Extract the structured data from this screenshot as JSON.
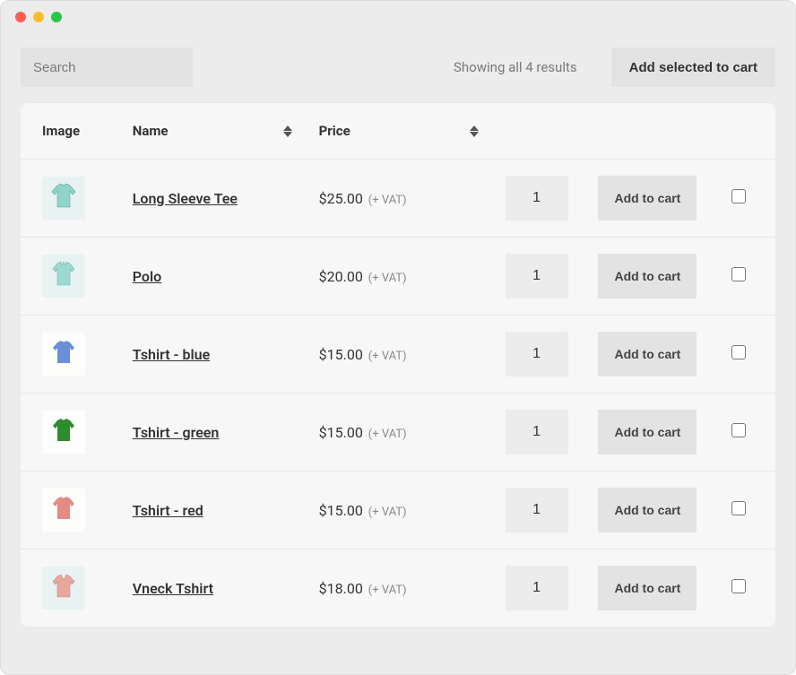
{
  "toolbar": {
    "search_placeholder": "Search",
    "results_text": "Showing all 4 results",
    "add_selected_label": "Add selected to cart"
  },
  "table": {
    "headers": {
      "image": "Image",
      "name": "Name",
      "price": "Price"
    },
    "vat_suffix": "(+ VAT)",
    "add_to_cart_label": "Add to cart",
    "rows": [
      {
        "name": "Long Sleeve Tee",
        "price": "$25.00",
        "qty": "1",
        "thumb_bg": "teal",
        "icon": "longsleeve",
        "icon_color": "#8ed4c9"
      },
      {
        "name": "Polo",
        "price": "$20.00",
        "qty": "1",
        "thumb_bg": "teal",
        "icon": "polo",
        "icon_color": "#9dd9d0"
      },
      {
        "name": "Tshirt - blue",
        "price": "$15.00",
        "qty": "1",
        "thumb_bg": "white",
        "icon": "tshirt",
        "icon_color": "#6a8fd8"
      },
      {
        "name": "Tshirt - green",
        "price": "$15.00",
        "qty": "1",
        "thumb_bg": "white",
        "icon": "tshirt",
        "icon_color": "#2e8b2e"
      },
      {
        "name": "Tshirt - red",
        "price": "$15.00",
        "qty": "1",
        "thumb_bg": "white",
        "icon": "tshirt",
        "icon_color": "#e38b84"
      },
      {
        "name": "Vneck Tshirt",
        "price": "$18.00",
        "qty": "1",
        "thumb_bg": "teal",
        "icon": "vneck",
        "icon_color": "#e7a79d"
      }
    ]
  }
}
